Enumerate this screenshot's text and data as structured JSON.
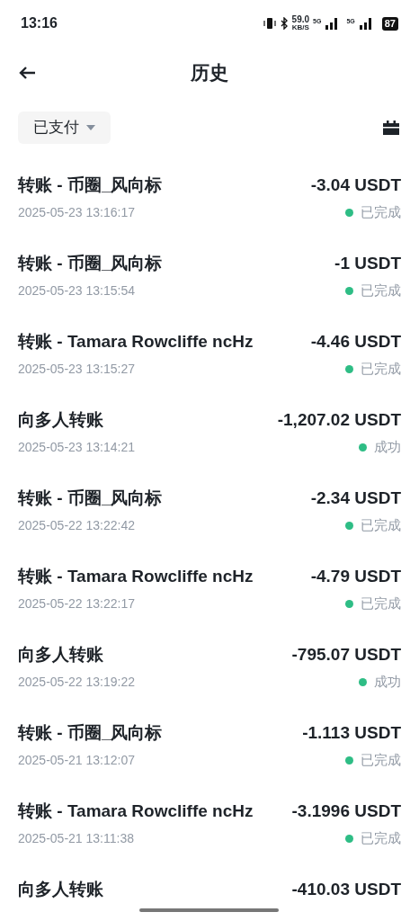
{
  "status_bar": {
    "time": "13:16",
    "speed": "59.0",
    "speed_unit": "KB/S",
    "network_1": "5G",
    "network_2": "5G",
    "battery": "87"
  },
  "header": {
    "title": "历史"
  },
  "filter": {
    "label": "已支付"
  },
  "transactions": [
    {
      "title": "转账 - 币圈_风向标",
      "amount": "-3.04 USDT",
      "time": "2025-05-23 13:16:17",
      "status": "已完成"
    },
    {
      "title": "转账 - 币圈_风向标",
      "amount": "-1 USDT",
      "time": "2025-05-23 13:15:54",
      "status": "已完成"
    },
    {
      "title": "转账 - Tamara Rowcliffe ncHz",
      "amount": "-4.46 USDT",
      "time": "2025-05-23 13:15:27",
      "status": "已完成"
    },
    {
      "title": "向多人转账",
      "amount": "-1,207.02 USDT",
      "time": "2025-05-23 13:14:21",
      "status": "成功"
    },
    {
      "title": "转账 - 币圈_风向标",
      "amount": "-2.34 USDT",
      "time": "2025-05-22 13:22:42",
      "status": "已完成"
    },
    {
      "title": "转账 - Tamara Rowcliffe ncHz",
      "amount": "-4.79 USDT",
      "time": "2025-05-22 13:22:17",
      "status": "已完成"
    },
    {
      "title": "向多人转账",
      "amount": "-795.07 USDT",
      "time": "2025-05-22 13:19:22",
      "status": "成功"
    },
    {
      "title": "转账 - 币圈_风向标",
      "amount": "-1.113 USDT",
      "time": "2025-05-21 13:12:07",
      "status": "已完成"
    },
    {
      "title": "转账 - Tamara Rowcliffe ncHz",
      "amount": "-3.1996 USDT",
      "time": "2025-05-21 13:11:38",
      "status": "已完成"
    },
    {
      "title": "向多人转账",
      "amount": "-410.03 USDT"
    }
  ]
}
